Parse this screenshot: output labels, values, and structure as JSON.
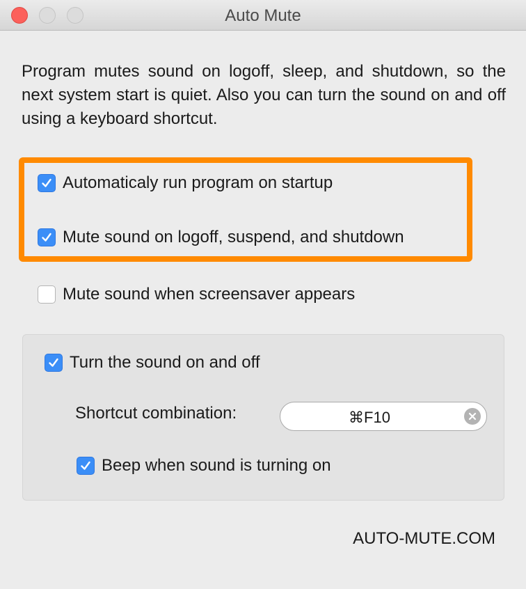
{
  "window": {
    "title": "Auto Mute"
  },
  "description": "Program mutes sound on logoff, sleep, and shutdown, so the next system start is quiet. Also you can turn the sound on and off using a keyboard shortcut.",
  "options": [
    {
      "label": "Automaticaly run program on startup",
      "checked": true
    },
    {
      "label": "Mute sound on logoff, suspend, and shutdown",
      "checked": true
    },
    {
      "label": "Mute sound when screensaver appears",
      "checked": false
    }
  ],
  "hotkey_group": {
    "toggle": {
      "label": "Turn the sound on and off",
      "checked": true
    },
    "shortcut_label": "Shortcut combination:",
    "shortcut_value": "⌘F10",
    "beep": {
      "label": "Beep when sound is turning on",
      "checked": true
    }
  },
  "footer": {
    "link": "AUTO-MUTE.COM"
  },
  "colors": {
    "accent": "#3b8ef7",
    "highlight": "#ff8a00",
    "close": "#fc605b"
  }
}
